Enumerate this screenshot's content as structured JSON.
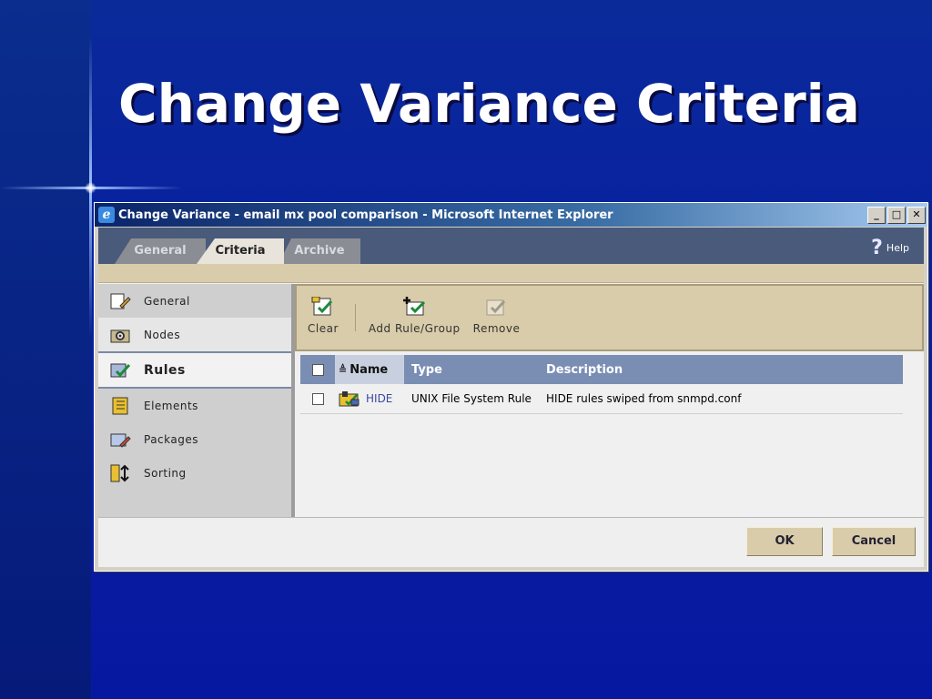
{
  "slide": {
    "title": "Change Variance Criteria"
  },
  "window": {
    "title": "Change Variance - email mx pool comparison - Microsoft Internet Explorer",
    "controls": {
      "minimize": "_",
      "maximize": "□",
      "close": "✕"
    }
  },
  "tabs": [
    {
      "label": "General"
    },
    {
      "label": "Criteria"
    },
    {
      "label": "Archive"
    }
  ],
  "help": {
    "label": "Help"
  },
  "sidebar": {
    "items": [
      {
        "label": "General",
        "icon": "edit-doc-icon"
      },
      {
        "label": "Nodes",
        "icon": "node-icon"
      },
      {
        "label": "Rules",
        "icon": "rules-icon"
      },
      {
        "label": "Elements",
        "icon": "elements-icon"
      },
      {
        "label": "Packages",
        "icon": "packages-icon"
      },
      {
        "label": "Sorting",
        "icon": "sort-icon"
      }
    ]
  },
  "toolbar": {
    "clear": "Clear",
    "add": "Add Rule/Group",
    "remove": "Remove"
  },
  "grid": {
    "columns": {
      "name": "Name",
      "type": "Type",
      "description": "Description"
    },
    "rows": [
      {
        "name": "HIDE",
        "type": "UNIX File System Rule",
        "description": "HIDE rules swiped from snmpd.conf"
      }
    ]
  },
  "footer": {
    "ok": "OK",
    "cancel": "Cancel"
  }
}
